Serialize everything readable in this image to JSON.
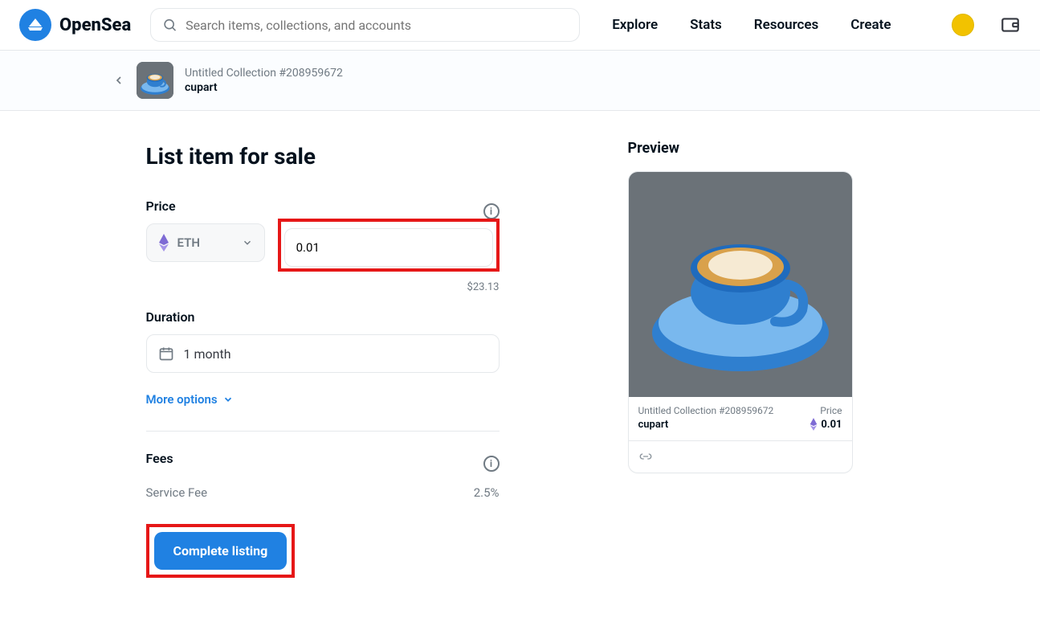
{
  "header": {
    "brand": "OpenSea",
    "search_placeholder": "Search items, collections, and accounts",
    "nav": {
      "explore": "Explore",
      "stats": "Stats",
      "resources": "Resources",
      "create": "Create"
    }
  },
  "subheader": {
    "collection": "Untitled Collection #208959672",
    "name": "cupart"
  },
  "form": {
    "page_title": "List item for sale",
    "price_label": "Price",
    "currency": "ETH",
    "amount": "0.01",
    "usd_display": "$23.13",
    "duration_label": "Duration",
    "duration_value": "1 month",
    "more_options": "More options",
    "fees_label": "Fees",
    "service_fee_label": "Service Fee",
    "service_fee_value": "2.5%",
    "complete_button": "Complete listing"
  },
  "preview": {
    "section_title": "Preview",
    "collection": "Untitled Collection #208959672",
    "price_label": "Price",
    "name": "cupart",
    "price_value": "0.01"
  }
}
